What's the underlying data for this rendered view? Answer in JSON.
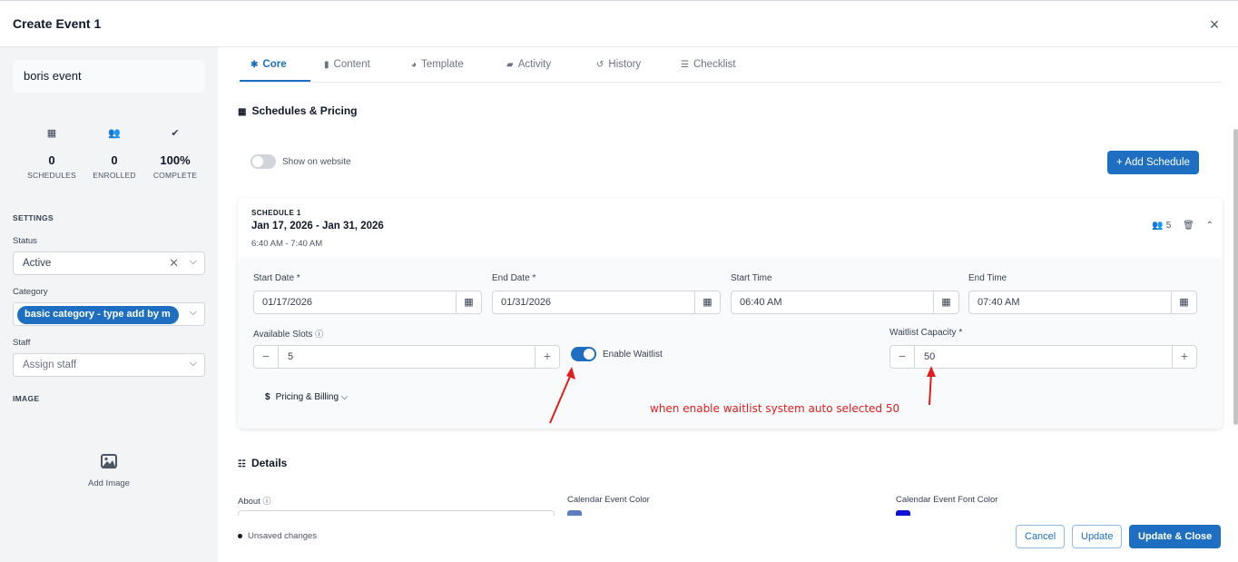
{
  "header": {
    "title": "Create Event 1",
    "close_icon": "×"
  },
  "sidebar": {
    "event_name": "boris event",
    "stats": [
      {
        "icon": "calendar-icon",
        "glyph": "▦",
        "value": "0",
        "label": "SCHEDULES"
      },
      {
        "icon": "users-icon",
        "glyph": "👥",
        "value": "0",
        "label": "ENROLLED"
      },
      {
        "icon": "check-circle-icon",
        "glyph": "✔",
        "value": "100%",
        "label": "COMPLETE"
      }
    ],
    "settings_label": "SETTINGS",
    "status": {
      "label": "Status",
      "value": "Active"
    },
    "category": {
      "label": "Category",
      "value": "basic category - type add by m"
    },
    "staff": {
      "label": "Staff",
      "placeholder": "Assign staff"
    },
    "image_label": "IMAGE",
    "add_image": "Add Image"
  },
  "tabs": [
    {
      "label": "Core",
      "icon": "gear-icon",
      "glyph": "✱",
      "active": true
    },
    {
      "label": "Content",
      "icon": "file-icon",
      "glyph": "▮",
      "active": false
    },
    {
      "label": "Template",
      "icon": "palette-icon",
      "glyph": "◕",
      "active": false
    },
    {
      "label": "Activity",
      "icon": "comments-icon",
      "glyph": "▰",
      "active": false
    },
    {
      "label": "History",
      "icon": "history-icon",
      "glyph": "↺",
      "active": false
    },
    {
      "label": "Checklist",
      "icon": "checklist-icon",
      "glyph": "☰",
      "active": false
    }
  ],
  "schedules": {
    "title": "Schedules & Pricing",
    "show_on_website": "Show on website",
    "add_schedule": "Add Schedule",
    "schedule": {
      "tag": "SCHEDULE 1",
      "dates": "Jan 17, 2026 - Jan 31, 2026",
      "time": "6:40 AM - 7:40 AM",
      "enrolled_count": "5",
      "start_date": {
        "label": "Start Date *",
        "value": "01/17/2026"
      },
      "end_date": {
        "label": "End Date *",
        "value": "01/31/2026"
      },
      "start_time": {
        "label": "Start Time",
        "value": "06:40 AM"
      },
      "end_time": {
        "label": "End Time",
        "value": "07:40 AM"
      },
      "available_slots": {
        "label": "Available Slots",
        "value": "5"
      },
      "enable_waitlist": {
        "label": "Enable Waitlist",
        "enabled": true
      },
      "waitlist_capacity": {
        "label": "Waitlist Capacity *",
        "value": "50"
      },
      "pricing_billing": "Pricing & Billing"
    },
    "annotation": "when enable waitlist system auto selected 50"
  },
  "details": {
    "title": "Details",
    "about_label": "About",
    "calendar_event_color": {
      "label": "Calendar Event Color",
      "color": "#5b7fbf"
    },
    "calendar_font_color": {
      "label": "Calendar Event Font Color",
      "color": "#1010d8"
    }
  },
  "footer": {
    "unsaved": "Unsaved changes",
    "cancel": "Cancel",
    "update": "Update",
    "update_close": "Update & Close"
  },
  "colors": {
    "accent": "#1e6fc2",
    "annotation": "#e11d1d"
  }
}
